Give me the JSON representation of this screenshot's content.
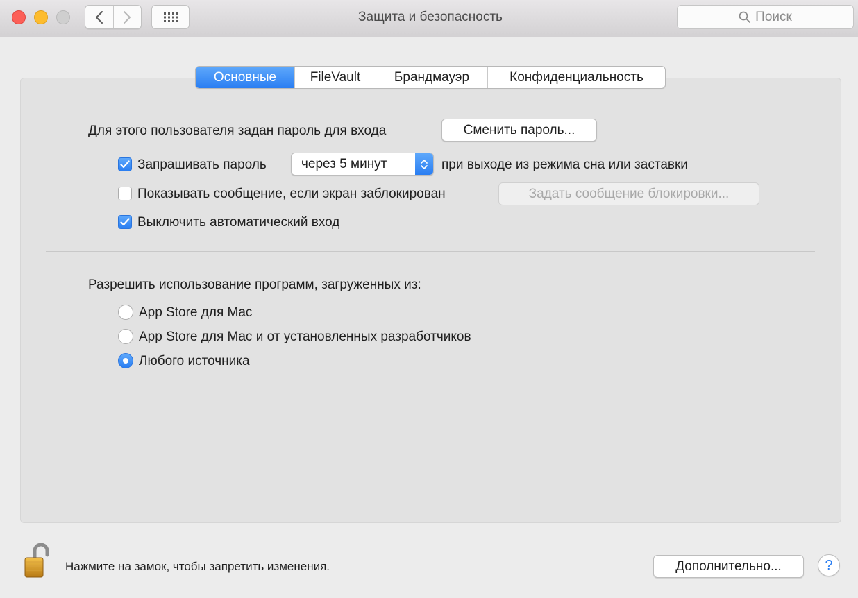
{
  "window": {
    "title": "Защита и безопасность",
    "search_placeholder": "Поиск"
  },
  "tabs": [
    {
      "label": "Основные",
      "active": true
    },
    {
      "label": "FileVault",
      "active": false
    },
    {
      "label": "Брандмауэр",
      "active": false
    },
    {
      "label": "Конфиденциальность",
      "active": false
    }
  ],
  "general": {
    "password_set_label": "Для этого пользователя задан пароль для входа",
    "change_password_button": "Сменить пароль...",
    "require_password": {
      "checked": true,
      "label": "Запрашивать пароль"
    },
    "require_delay": {
      "selected": "через 5 минут"
    },
    "require_suffix": "при выходе из режима сна или заставки",
    "show_message": {
      "checked": false,
      "label": "Показывать сообщение, если экран заблокирован"
    },
    "set_lock_message_button": "Задать сообщение блокировки...",
    "disable_autologin": {
      "checked": true,
      "label": "Выключить автоматический вход"
    }
  },
  "allow_apps": {
    "heading": "Разрешить использование программ, загруженных из:",
    "options": [
      {
        "label": "App Store для Mac",
        "selected": false
      },
      {
        "label": "App Store для Mac и от установленных разработчиков",
        "selected": false
      },
      {
        "label": "Любого источника",
        "selected": true
      }
    ]
  },
  "footer": {
    "lock_text": "Нажмите на замок, чтобы запретить изменения.",
    "advanced_button": "Дополнительно...",
    "help_symbol": "?"
  },
  "colors": {
    "accent": "#2a7ef2",
    "close": "#fc5f57",
    "minimize": "#fdbc2e",
    "zoom_disabled": "#cfcfcf"
  }
}
